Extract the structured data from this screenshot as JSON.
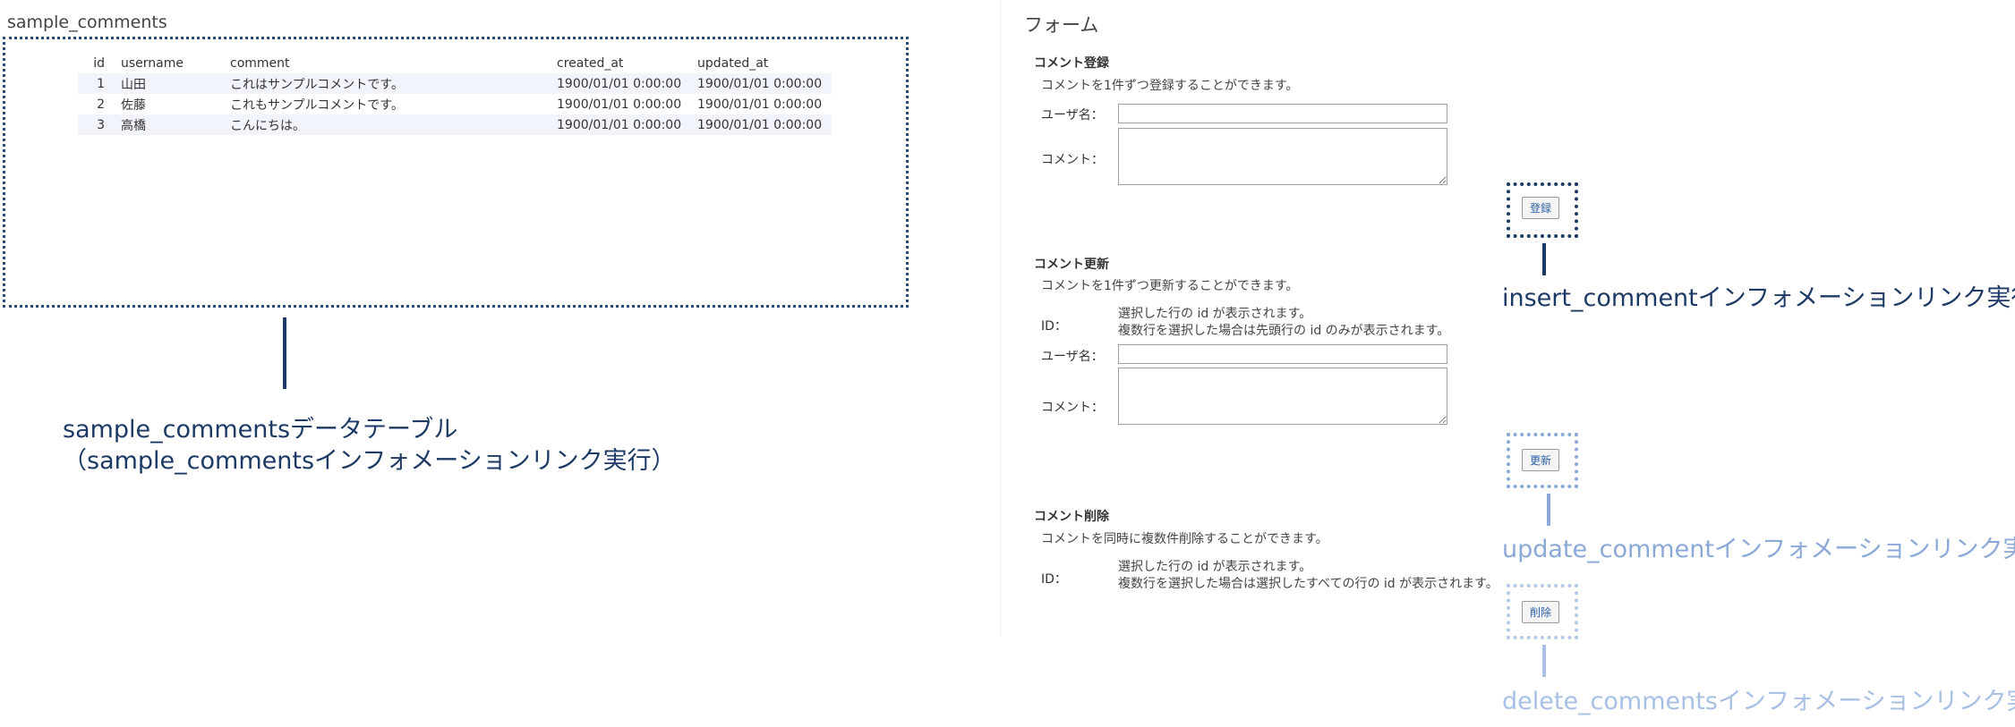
{
  "left_panel": {
    "title": "sample_comments",
    "table": {
      "headers": [
        "id",
        "username",
        "comment",
        "created_at",
        "updated_at"
      ],
      "rows": [
        {
          "id": "1",
          "username": "山田",
          "comment": "これはサンプルコメントです。",
          "created_at": "1900/01/01 0:00:00",
          "updated_at": "1900/01/01 0:00:00"
        },
        {
          "id": "2",
          "username": "佐藤",
          "comment": "これもサンプルコメントです。",
          "created_at": "1900/01/01 0:00:00",
          "updated_at": "1900/01/01 0:00:00"
        },
        {
          "id": "3",
          "username": "高橋",
          "comment": "こんにちは。",
          "created_at": "1900/01/01 0:00:00",
          "updated_at": "1900/01/01 0:00:00"
        }
      ]
    },
    "callout_line1": "sample_commentsデータテーブル",
    "callout_line2": "（sample_commentsインフォメーションリンク実行）"
  },
  "right_panel": {
    "title": "フォーム",
    "insert_section": {
      "title": "コメント登録",
      "description": "コメントを1件ずつ登録することができます。",
      "username_label": "ユーザ名：",
      "comment_label": "コメント：",
      "username_value": "",
      "comment_value": "",
      "button_label": "登録",
      "callout": "insert_commentインフォメーションリンク実行"
    },
    "update_section": {
      "title": "コメント更新",
      "description": "コメントを1件ずつ更新することができます。",
      "id_label": "ID：",
      "id_note_line1": "選択した行の id が表示されます。",
      "id_note_line2": "複数行を選択した場合は先頭行の id のみが表示されます。",
      "username_label": "ユーザ名：",
      "comment_label": "コメント：",
      "username_value": "",
      "comment_value": "",
      "button_label": "更新",
      "callout": "update_commentインフォメーションリンク実行"
    },
    "delete_section": {
      "title": "コメント削除",
      "description": "コメントを同時に複数件削除することができます。",
      "id_label": "ID：",
      "id_note_line1": "選択した行の id が表示されます。",
      "id_note_line2": "複数行を選択した場合は選択したすべての行の id が表示されます。",
      "button_label": "削除",
      "callout": "delete_commentsインフォメーションリンク実行"
    }
  },
  "colors": {
    "callout_dark": "#1d3a66",
    "callout_mid": "#8aa8d8",
    "callout_light": "#a8c0e6",
    "row_stripe": "#f1f4fb",
    "button_text": "#2b5ea8"
  }
}
